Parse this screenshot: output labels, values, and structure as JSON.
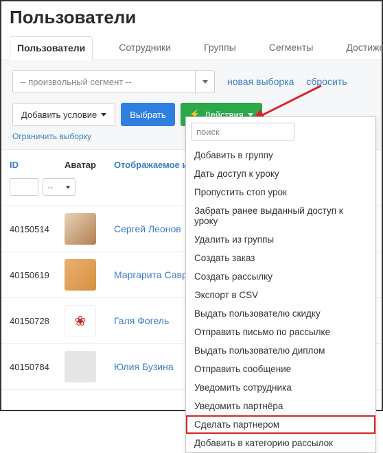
{
  "page": {
    "title": "Пользователи"
  },
  "tabs": [
    {
      "label": "Пользователи",
      "active": true
    },
    {
      "label": "Сотрудники"
    },
    {
      "label": "Группы"
    },
    {
      "label": "Сегменты"
    },
    {
      "label": "Достижения"
    }
  ],
  "filter": {
    "segment_placeholder": "-- произвольный сегмент --",
    "new_selection": "новая выборка",
    "reset": "сбросить",
    "add_condition": "Добавить условие",
    "select": "Выбрать",
    "actions": "Действия",
    "limit": "Ограничить выборку"
  },
  "table": {
    "headers": {
      "id": "ID",
      "avatar": "Аватар",
      "name": "Отображаемое имя"
    },
    "avatar_filter_placeholder": "--",
    "rows": [
      {
        "id": "40150514",
        "name": "Сергей Леонов"
      },
      {
        "id": "40150619",
        "name": "Маргарита Савреева"
      },
      {
        "id": "40150728",
        "name": "Галя Фогель"
      },
      {
        "id": "40150784",
        "name": "Юлия Бузина"
      }
    ]
  },
  "dropdown": {
    "search_placeholder": "поиск",
    "items": [
      "Добавить в группу",
      "Дать доступ к уроку",
      "Пропустить стоп урок",
      "Забрать ранее выданный доступ к уроку",
      "Удалить из группы",
      "Создать заказ",
      "Создать рассылку",
      "Экспорт в CSV",
      "Выдать пользователю скидку",
      "Отправить письмо по рассылке",
      "Выдать пользователю диплом",
      "Отправить сообщение",
      "Уведомить сотрудника",
      "Уведомить партнёра",
      "Сделать партнером",
      "Добавить в категорию рассылок"
    ],
    "highlighted_index": 14
  }
}
